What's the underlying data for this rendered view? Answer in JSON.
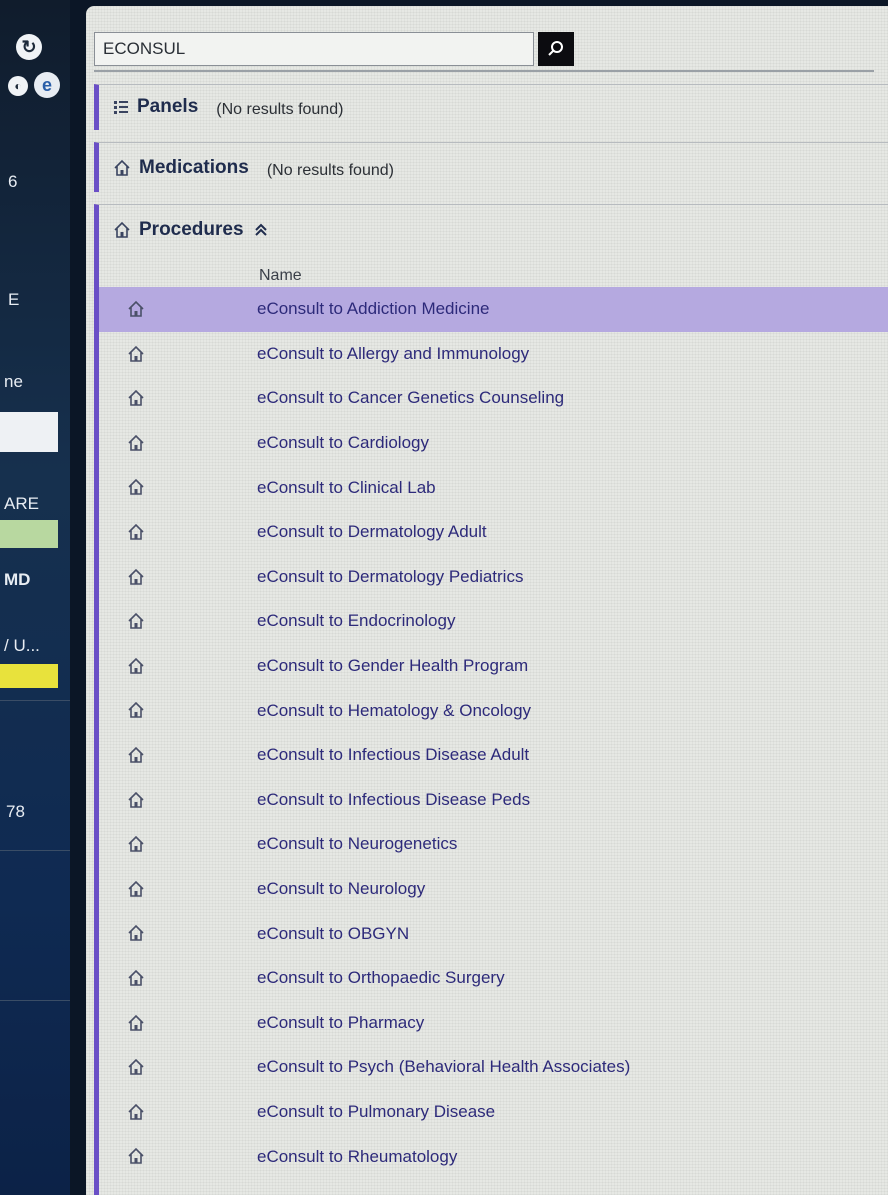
{
  "sidebar": {
    "fragments": [
      "E",
      "ne",
      "ARE",
      "MD",
      "/ U...",
      "78",
      "6"
    ]
  },
  "search": {
    "value": "ECONSUL",
    "icon": "magnifier-icon"
  },
  "panels": {
    "title": "Panels",
    "message": "(No results found)"
  },
  "medications": {
    "title": "Medications",
    "message": "(No results found)"
  },
  "procedures": {
    "title": "Procedures",
    "collapse_glyph": "≈",
    "column_header": "Name",
    "items": [
      {
        "name": "eConsult to Addiction Medicine",
        "selected": true
      },
      {
        "name": "eConsult to Allergy and Immunology"
      },
      {
        "name": "eConsult to Cancer Genetics Counseling"
      },
      {
        "name": "eConsult to Cardiology"
      },
      {
        "name": "eConsult to Clinical Lab"
      },
      {
        "name": "eConsult to Dermatology Adult"
      },
      {
        "name": "eConsult to Dermatology Pediatrics"
      },
      {
        "name": "eConsult to Endocrinology"
      },
      {
        "name": "eConsult to Gender Health Program"
      },
      {
        "name": "eConsult to Hematology & Oncology"
      },
      {
        "name": "eConsult to Infectious Disease Adult"
      },
      {
        "name": "eConsult to Infectious Disease Peds"
      },
      {
        "name": "eConsult to Neurogenetics"
      },
      {
        "name": "eConsult to Neurology"
      },
      {
        "name": "eConsult to OBGYN"
      },
      {
        "name": "eConsult to Orthopaedic Surgery"
      },
      {
        "name": "eConsult to Pharmacy"
      },
      {
        "name": "eConsult to Psych (Behavioral Health Associates)"
      },
      {
        "name": "eConsult to Pulmonary Disease"
      },
      {
        "name": "eConsult to Rheumatology"
      }
    ]
  },
  "colors": {
    "accent": "#6a4fc6",
    "selected_row": "#b5a9e0",
    "link_text": "#2d2a7a"
  }
}
